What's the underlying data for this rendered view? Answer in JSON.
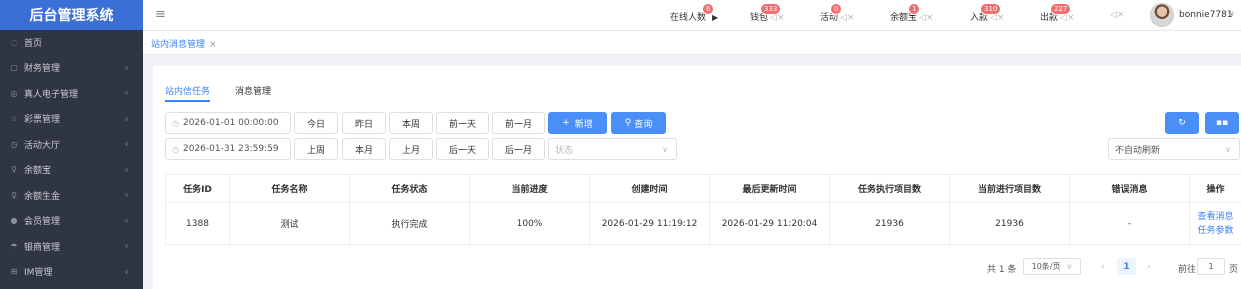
{
  "app": {
    "title": "后台管理系统"
  },
  "sidebar": {
    "items": [
      {
        "icon": "◌",
        "label": "首页"
      },
      {
        "icon": "▢",
        "label": "财务管理"
      },
      {
        "icon": "◎",
        "label": "真人电子管理"
      },
      {
        "icon": "☆",
        "label": "彩票管理"
      },
      {
        "icon": "◷",
        "label": "活动大厅"
      },
      {
        "icon": "♀",
        "label": "余额宝"
      },
      {
        "icon": "♀",
        "label": "余额生金"
      },
      {
        "icon": "●",
        "label": "会员管理"
      },
      {
        "icon": "☂",
        "label": "银商管理"
      },
      {
        "icon": "⊞",
        "label": "IM管理"
      }
    ]
  },
  "topbar": {
    "online_label": "在线人数",
    "online_badge": "6",
    "wallet_label": "钱包",
    "wallet_badge": "333",
    "activity_label": "活动",
    "activity_badge": "0",
    "yuebao_label": "余额宝",
    "yuebao_badge": "1",
    "deposit_label": "入款",
    "deposit_badge": "310",
    "withdraw_label": "出款",
    "withdraw_badge": "227",
    "username": "bonnie7781"
  },
  "tabs": {
    "current": "站内消息管理"
  },
  "subtabs": {
    "tasks": "站内信任务",
    "messages": "消息管理"
  },
  "filters": {
    "start_time": "2026-01-01 00:00:00",
    "end_time": "2026-01-31 23:59:59",
    "today": "今日",
    "yesterday": "昨日",
    "this_week": "本周",
    "prev_day": "前一天",
    "prev_month": "前一月",
    "last_week": "上周",
    "this_month": "本月",
    "last_month": "上月",
    "next_day": "后一天",
    "next_month": "后一月",
    "add": "新增",
    "query": "查询",
    "status_placeholder": "状态",
    "refresh_option": "不自动刷新"
  },
  "table": {
    "headers": [
      "任务ID",
      "任务名称",
      "任务状态",
      "当前进度",
      "创建时间",
      "最后更新时间",
      "任务执行项目数",
      "当前进行项目数",
      "错误消息",
      "操作"
    ],
    "rows": [
      {
        "id": "1388",
        "name": "测试",
        "status": "执行完成",
        "progress": "100%",
        "created": "2026-01-29 11:19:12",
        "updated": "2026-01-29 11:20:04",
        "total_items": "21936",
        "current_items": "21936",
        "error": "-",
        "action_view": "查看消息",
        "action_params": "任务参数"
      }
    ]
  },
  "pagination": {
    "total": "共 1 条",
    "page_size": "10条/页",
    "current_page": "1",
    "goto_prefix": "前往",
    "goto_value": "1",
    "goto_suffix": "页"
  },
  "colors": {
    "accent": "#3a82f7",
    "sidebar": "#2f3542",
    "brand": "#3a6fd8",
    "badge": "#f56c6c"
  }
}
